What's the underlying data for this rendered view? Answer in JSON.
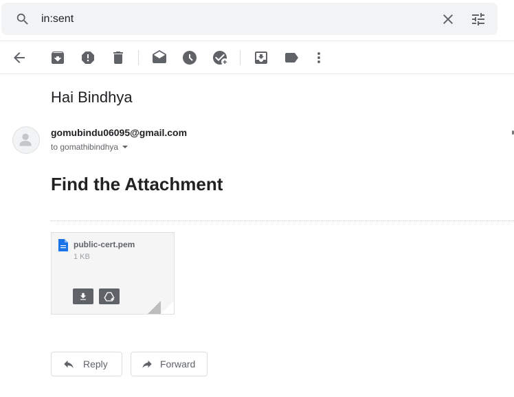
{
  "search": {
    "query": "in:sent"
  },
  "icons": {
    "search": "search-icon",
    "clear": "close-icon",
    "tune": "tune-icon",
    "back": "arrow-back-icon",
    "archive": "archive-icon",
    "spam": "report-spam-icon",
    "delete": "delete-icon",
    "mark_unread": "mark-unread-icon",
    "snooze": "snooze-icon",
    "add_task": "add-task-icon",
    "move_to": "move-to-inbox-icon",
    "label": "label-icon",
    "more": "more-vert-icon"
  },
  "email": {
    "subject": "Hai Bindhya",
    "sender": "gomubindu06095@gmail.com",
    "recipient": "to gomathibindhya",
    "body": "Find the Attachment"
  },
  "attachment": {
    "name": "public-cert.pem",
    "size": "1 KB"
  },
  "actions": {
    "reply": "Reply",
    "forward": "Forward"
  },
  "colors": {
    "accent_file": "#1a73e8",
    "icon_grey": "#5f6368"
  }
}
